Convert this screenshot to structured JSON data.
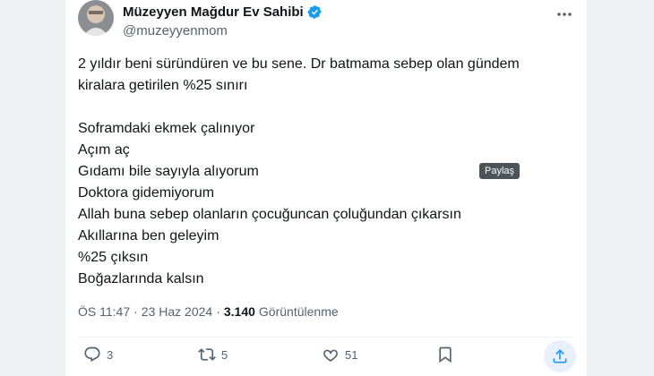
{
  "tweet": {
    "display_name": "Müzeyyen Mağdur Ev Sahibi",
    "handle": "@muzeyyenmom",
    "lines": [
      "2 yıldır beni süründüren  ve bu sene. Dr batmama sebep olan gündem",
      "kiralara getirilen %25 sınırı",
      "",
      "Soframdaki ekmek çalınıyor",
      "Açım aç",
      "Gıdamı bile sayıyla alıyorum",
      "Doktora gidemiyorum",
      "Allah buna sebep olanların çocuğuncan çoluğundan çıkarsın",
      "Akıllarına ben geleyim",
      "%25 çıksın",
      "Boğazlarında kalsın"
    ],
    "time": "ÖS 11:47",
    "date": "23 Haz 2024",
    "dot": "·",
    "views_count": "3.140",
    "views_label": "Görüntülenme"
  },
  "actions": {
    "replies": "3",
    "retweets": "5",
    "likes": "51",
    "share_tooltip": "Paylaş"
  },
  "icons": {
    "verified": "verified-badge-icon",
    "more": "more-dots-icon",
    "reply": "reply-icon",
    "retweet": "retweet-icon",
    "like": "heart-icon",
    "bookmark": "bookmark-icon",
    "share": "share-icon"
  },
  "colors": {
    "accent": "#1d9bf0",
    "text": "#0f1419",
    "muted": "#536471"
  }
}
